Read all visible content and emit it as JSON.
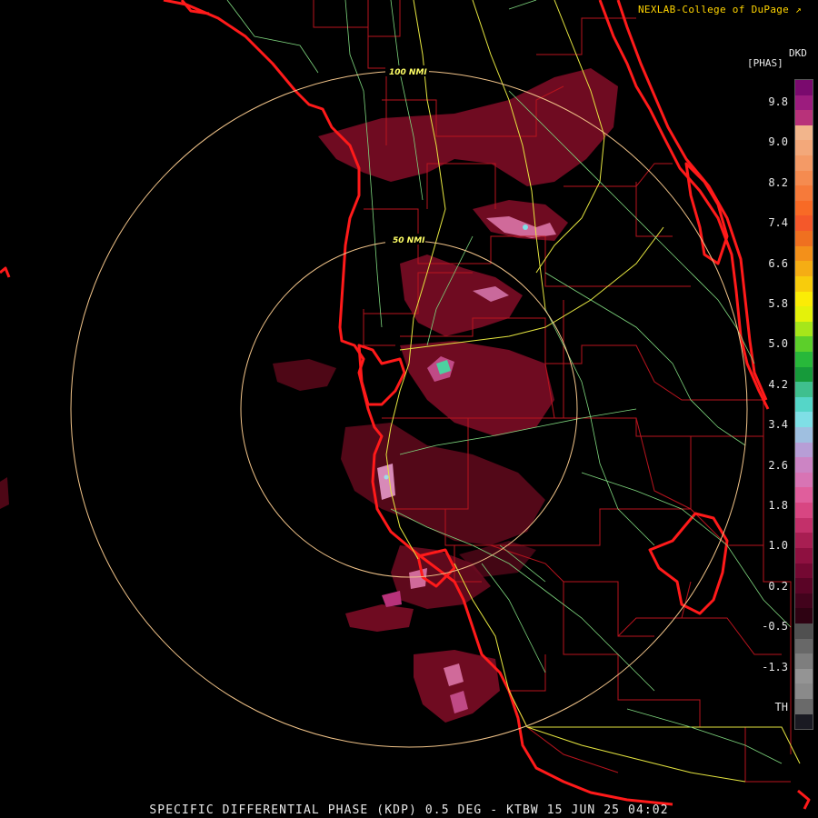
{
  "header": {
    "credit": "NEXLAB-College of DuPage",
    "credit_icon": "external-link-arrow-icon"
  },
  "product": {
    "code": "DKD",
    "units": "[PHAS]"
  },
  "range_rings": [
    {
      "label": "50 NMI",
      "radius_nmi": 50
    },
    {
      "label": "100 NMI",
      "radius_nmi": 100
    }
  ],
  "legend": {
    "ticks": [
      "9.8",
      "9.0",
      "8.2",
      "7.4",
      "6.6",
      "5.8",
      "5.0",
      "4.2",
      "3.4",
      "2.6",
      "1.8",
      "1.0",
      "0.2",
      "-0.5",
      "-1.3",
      "TH"
    ],
    "colors": [
      "#7a0a6e",
      "#9c1c7e",
      "#b8327a",
      "#f2b58c",
      "#f3a87a",
      "#f49a66",
      "#f58b50",
      "#f67a3a",
      "#f86a26",
      "#f4582a",
      "#ef7020",
      "#f3901a",
      "#f5ad14",
      "#f8cc0c",
      "#fbec06",
      "#e4f20a",
      "#a6e61a",
      "#5ccf2a",
      "#28b83a",
      "#169a3a",
      "#3fbf8e",
      "#55d6c8",
      "#7fdfe6",
      "#9fbfe0",
      "#b79ed6",
      "#cc84c4",
      "#d874b4",
      "#e05e9c",
      "#d84682",
      "#c3306a",
      "#a81e52",
      "#8e1040",
      "#740832",
      "#5a0426",
      "#42031c",
      "#2e0212",
      "#505050",
      "#686868",
      "#7e7e7e",
      "#949494",
      "#8a8a8a",
      "#6a6a6a",
      "#1a1a22"
    ]
  },
  "footer": {
    "text": "SPECIFIC DIFFERENTIAL PHASE (KDP) 0.5 DEG - KTBW 15 JUN 25 04:02"
  }
}
